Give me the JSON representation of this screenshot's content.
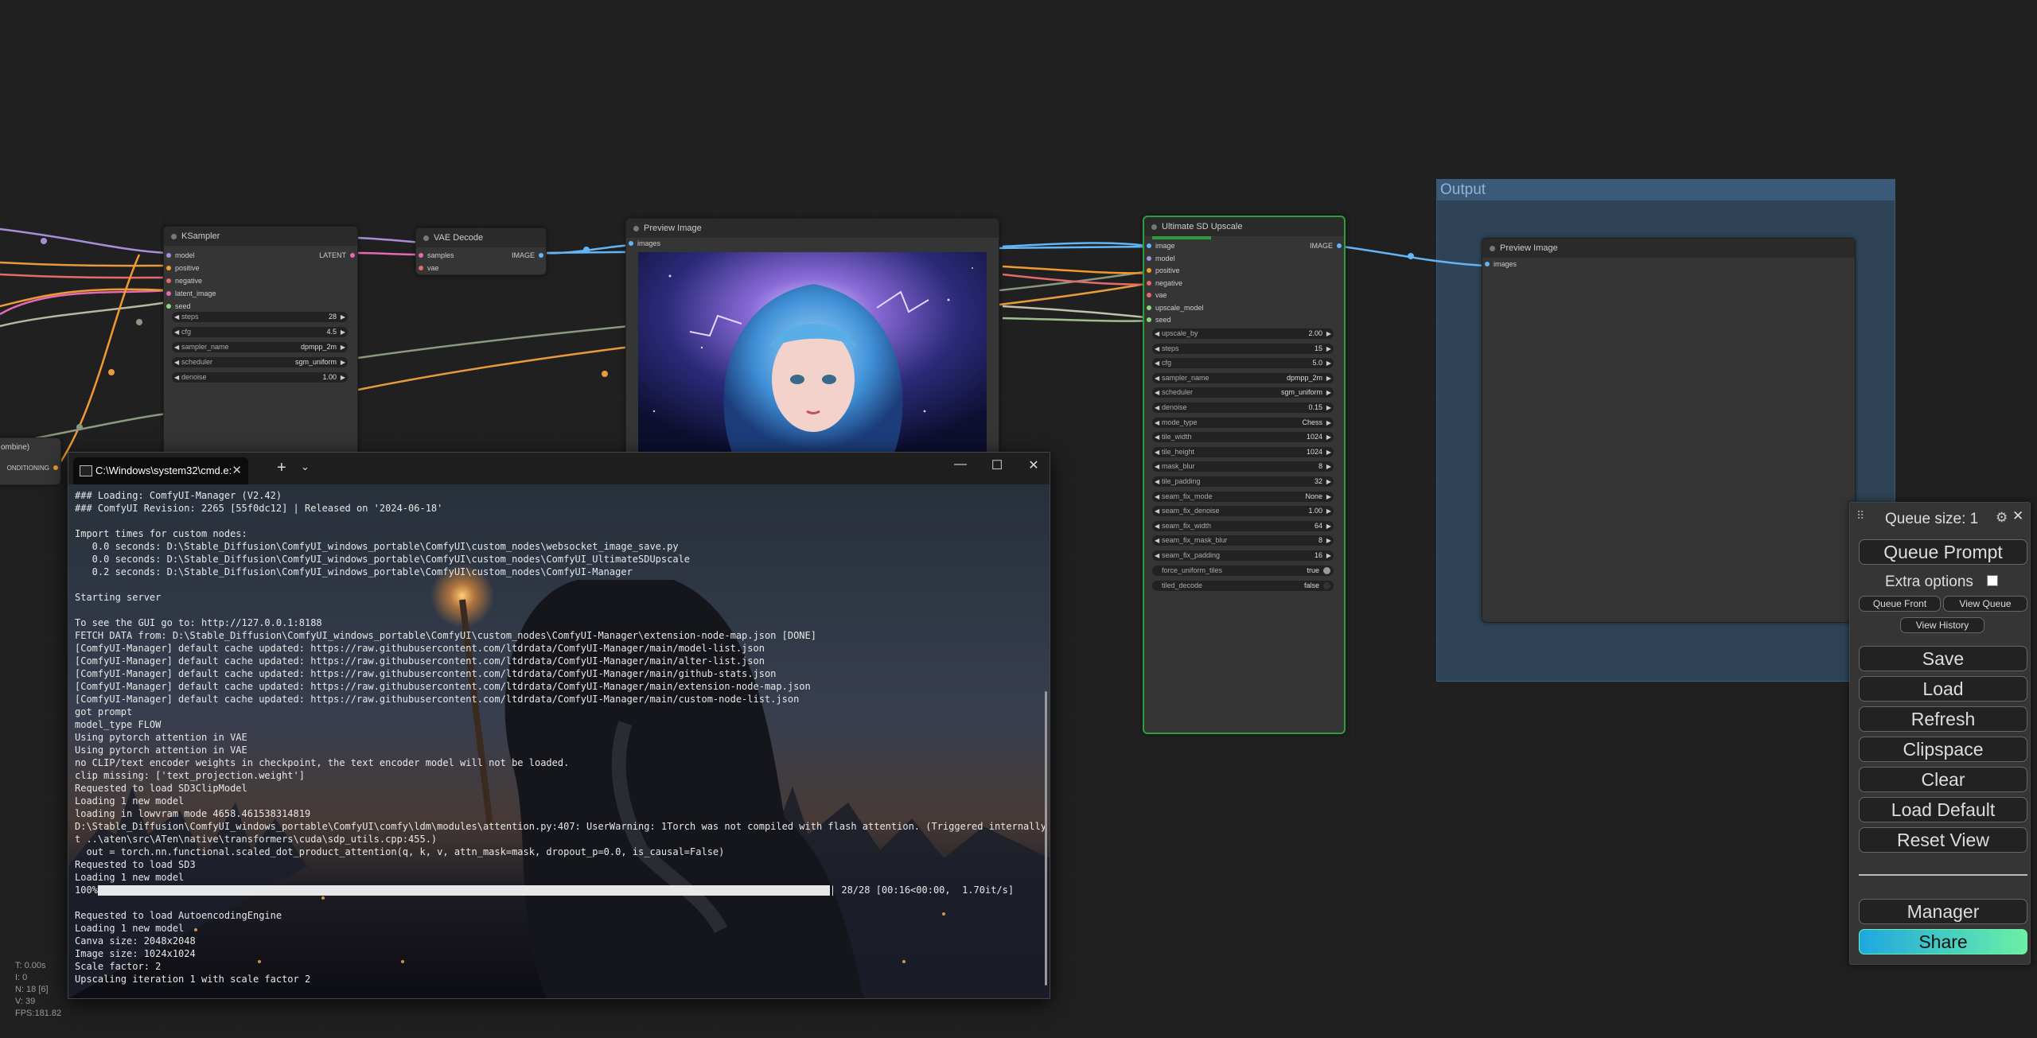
{
  "canvas": {
    "background": "#202020"
  },
  "group": {
    "title": "Output",
    "color": "#335577"
  },
  "nodes": {
    "ksampler": {
      "title": "KSampler",
      "inputs": [
        "model",
        "positive",
        "negative",
        "latent_image",
        "seed"
      ],
      "output": "LATENT",
      "widgets": [
        {
          "label": "steps",
          "value": "28"
        },
        {
          "label": "cfg",
          "value": "4.5"
        },
        {
          "label": "sampler_name",
          "value": "dpmpp_2m"
        },
        {
          "label": "scheduler",
          "value": "sgm_uniform"
        },
        {
          "label": "denoise",
          "value": "1.00"
        }
      ]
    },
    "vae_decode": {
      "title": "VAE Decode",
      "inputs": [
        "samples",
        "vae"
      ],
      "output": "IMAGE"
    },
    "preview1": {
      "title": "Preview Image",
      "inputs": [
        "images"
      ]
    },
    "ultimate": {
      "title": "Ultimate SD Upscale",
      "inputs": [
        "image",
        "model",
        "positive",
        "negative",
        "vae",
        "upscale_model",
        "seed"
      ],
      "output": "IMAGE",
      "widgets": [
        {
          "label": "upscale_by",
          "value": "2.00"
        },
        {
          "label": "steps",
          "value": "15"
        },
        {
          "label": "cfg",
          "value": "5.0"
        },
        {
          "label": "sampler_name",
          "value": "dpmpp_2m"
        },
        {
          "label": "scheduler",
          "value": "sgm_uniform"
        },
        {
          "label": "denoise",
          "value": "0.15"
        },
        {
          "label": "mode_type",
          "value": "Chess"
        },
        {
          "label": "tile_width",
          "value": "1024"
        },
        {
          "label": "tile_height",
          "value": "1024"
        },
        {
          "label": "mask_blur",
          "value": "8"
        },
        {
          "label": "tile_padding",
          "value": "32"
        },
        {
          "label": "seam_fix_mode",
          "value": "None"
        },
        {
          "label": "seam_fix_denoise",
          "value": "1.00"
        },
        {
          "label": "seam_fix_width",
          "value": "64"
        },
        {
          "label": "seam_fix_mask_blur",
          "value": "8"
        },
        {
          "label": "seam_fix_padding",
          "value": "16"
        }
      ],
      "toggles": [
        {
          "label": "force_uniform_tiles",
          "value": "true"
        },
        {
          "label": "tiled_decode",
          "value": "false"
        }
      ]
    },
    "preview2": {
      "title": "Preview Image",
      "inputs": [
        "images"
      ]
    },
    "partial_left": {
      "text": "ombine)",
      "output": "ONDITIONING"
    }
  },
  "terminal": {
    "tab_title": "C:\\Windows\\system32\\cmd.e:",
    "new_tab": "+",
    "lines": [
      "### Loading: ComfyUI-Manager (V2.42)",
      "### ComfyUI Revision: 2265 [55f0dc12] | Released on '2024-06-18'",
      "",
      "Import times for custom nodes:",
      "   0.0 seconds: D:\\Stable_Diffusion\\ComfyUI_windows_portable\\ComfyUI\\custom_nodes\\websocket_image_save.py",
      "   0.0 seconds: D:\\Stable_Diffusion\\ComfyUI_windows_portable\\ComfyUI\\custom_nodes\\ComfyUI_UltimateSDUpscale",
      "   0.2 seconds: D:\\Stable_Diffusion\\ComfyUI_windows_portable\\ComfyUI\\custom_nodes\\ComfyUI-Manager",
      "",
      "Starting server",
      "",
      "To see the GUI go to: http://127.0.0.1:8188",
      "FETCH DATA from: D:\\Stable_Diffusion\\ComfyUI_windows_portable\\ComfyUI\\custom_nodes\\ComfyUI-Manager\\extension-node-map.json [DONE]",
      "[ComfyUI-Manager] default cache updated: https://raw.githubusercontent.com/ltdrdata/ComfyUI-Manager/main/model-list.json",
      "[ComfyUI-Manager] default cache updated: https://raw.githubusercontent.com/ltdrdata/ComfyUI-Manager/main/alter-list.json",
      "[ComfyUI-Manager] default cache updated: https://raw.githubusercontent.com/ltdrdata/ComfyUI-Manager/main/github-stats.json",
      "[ComfyUI-Manager] default cache updated: https://raw.githubusercontent.com/ltdrdata/ComfyUI-Manager/main/extension-node-map.json",
      "[ComfyUI-Manager] default cache updated: https://raw.githubusercontent.com/ltdrdata/ComfyUI-Manager/main/custom-node-list.json",
      "got prompt",
      "model_type FLOW",
      "Using pytorch attention in VAE",
      "Using pytorch attention in VAE",
      "no CLIP/text encoder weights in checkpoint, the text encoder model will not be loaded.",
      "clip missing: ['text_projection.weight']",
      "Requested to load SD3ClipModel",
      "Loading 1 new model",
      "loading in lowvram mode 4658.461538314819",
      "D:\\Stable_Diffusion\\ComfyUI_windows_portable\\ComfyUI\\comfy\\ldm\\modules\\attention.py:407: UserWarning: 1Torch was not compiled with flash attention. (Triggered internally a",
      "t ..\\aten\\src\\ATen\\native\\transformers\\cuda\\sdp_utils.cpp:455.)",
      "  out = torch.nn.functional.scaled_dot_product_attention(q, k, v, attn_mask=mask, dropout_p=0.0, is_causal=False)",
      "Requested to load SD3",
      "Loading 1 new model",
      "",
      "Requested to load AutoencodingEngine",
      "Loading 1 new model",
      "Canva size: 2048x2048",
      "Image size: 1024x1024",
      "Scale factor: 2",
      "Upscaling iteration 1 with scale factor 2"
    ],
    "progress": {
      "percent_label": "100%",
      "fraction": 1.0,
      "suffix": "| 28/28 [00:16<00:00,  1.70it/s]"
    }
  },
  "queue_panel": {
    "queue_size": "Queue size: 1",
    "queue_prompt": "Queue Prompt",
    "extra_options": "Extra options",
    "queue_front": "Queue Front",
    "view_queue": "View Queue",
    "view_history": "View History",
    "buttons": [
      "Save",
      "Load",
      "Refresh",
      "Clipspace",
      "Clear",
      "Load Default",
      "Reset View"
    ],
    "manager": "Manager",
    "share": "Share",
    "share_gradient": [
      "#1ea7e1",
      "#6bf0a6"
    ]
  },
  "stats": [
    "T: 0.00s",
    "I: 0",
    "N: 18 [6]",
    "V: 39",
    "FPS:181.82"
  ]
}
